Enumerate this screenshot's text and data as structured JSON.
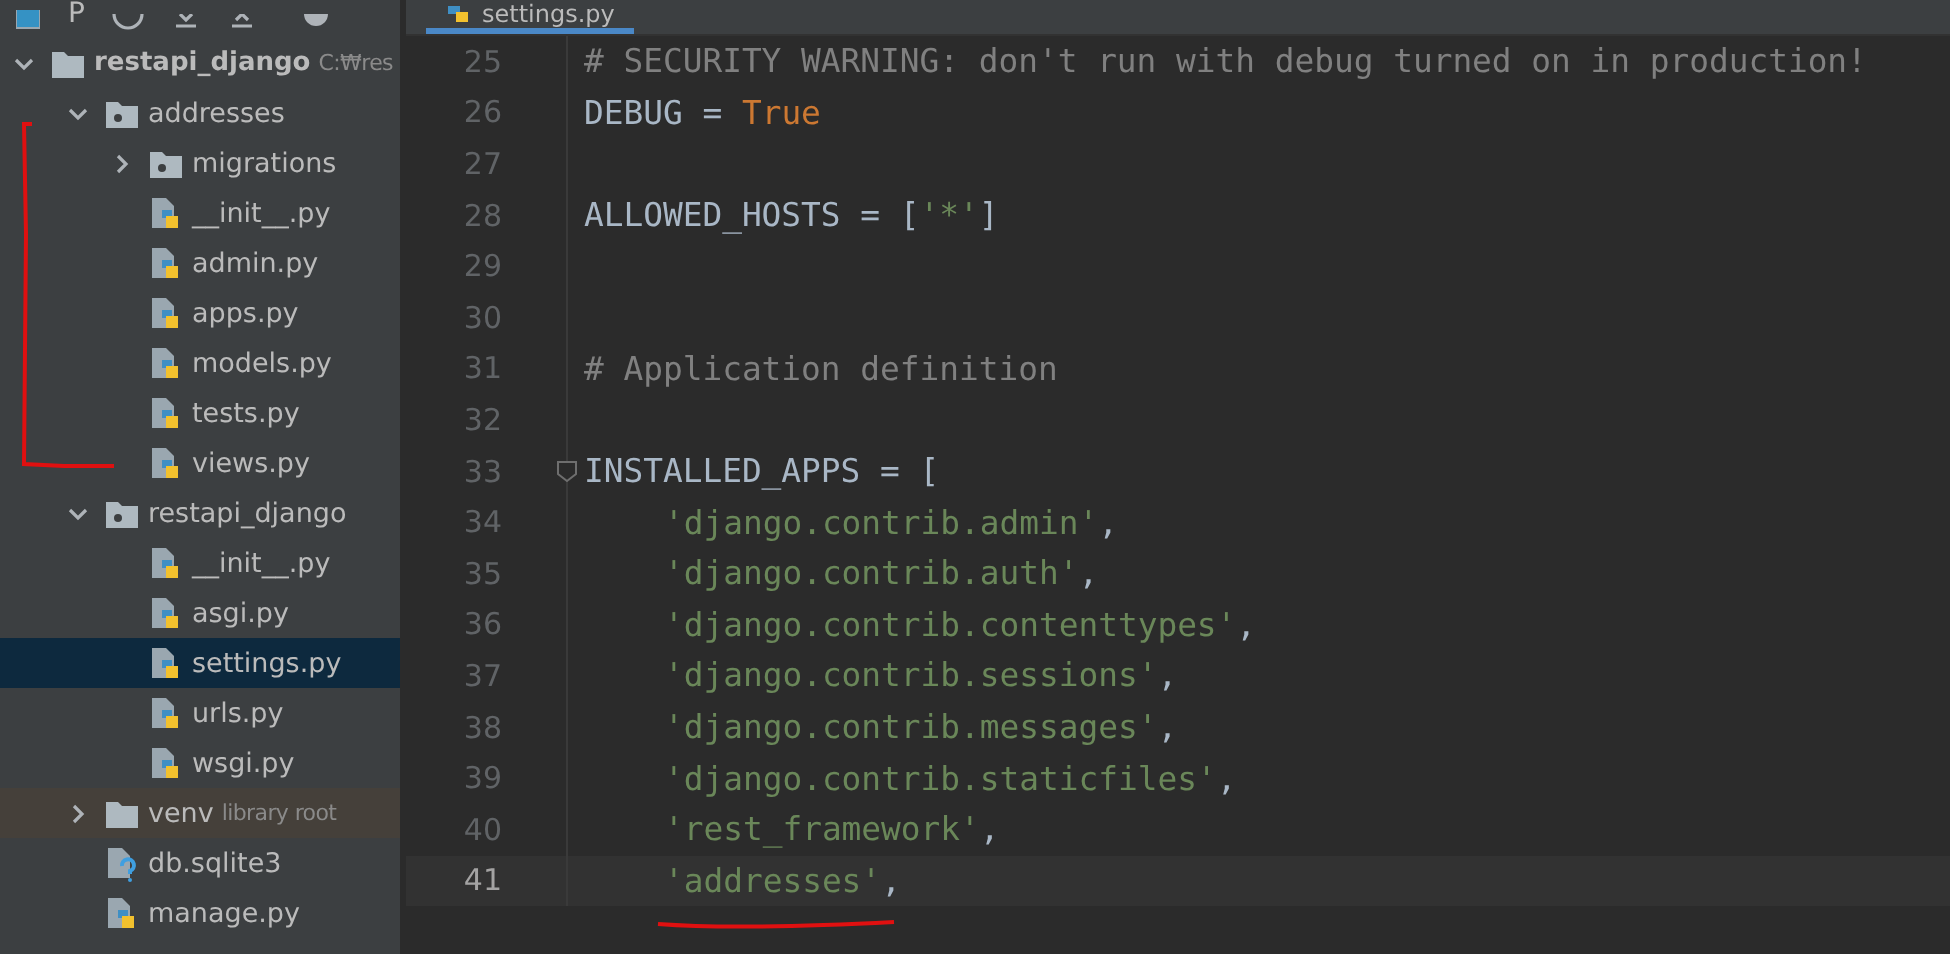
{
  "project_toolbar": {
    "title": "P"
  },
  "tree": [
    {
      "label": "restapi_django",
      "kind": "root",
      "hint": "C:₩res",
      "expanded": true,
      "selected": false,
      "children": [
        {
          "label": "addresses",
          "kind": "package",
          "expanded": true,
          "selected": false,
          "children": [
            {
              "label": "migrations",
              "kind": "package",
              "expanded": false,
              "selected": false
            },
            {
              "label": "__init__.py",
              "kind": "python",
              "selected": false
            },
            {
              "label": "admin.py",
              "kind": "python",
              "selected": false
            },
            {
              "label": "apps.py",
              "kind": "python",
              "selected": false
            },
            {
              "label": "models.py",
              "kind": "python",
              "selected": false
            },
            {
              "label": "tests.py",
              "kind": "python",
              "selected": false
            },
            {
              "label": "views.py",
              "kind": "python",
              "selected": false
            }
          ]
        },
        {
          "label": "restapi_django",
          "kind": "package",
          "expanded": true,
          "selected": false,
          "children": [
            {
              "label": "__init__.py",
              "kind": "python",
              "selected": false
            },
            {
              "label": "asgi.py",
              "kind": "python",
              "selected": false
            },
            {
              "label": "settings.py",
              "kind": "python",
              "selected": true
            },
            {
              "label": "urls.py",
              "kind": "python",
              "selected": false
            },
            {
              "label": "wsgi.py",
              "kind": "python",
              "selected": false
            }
          ]
        },
        {
          "label": "venv",
          "kind": "library",
          "hint": "library root",
          "expanded": false,
          "selected": false
        },
        {
          "label": "db.sqlite3",
          "kind": "unknown",
          "selected": false
        },
        {
          "label": "manage.py",
          "kind": "python",
          "selected": false
        }
      ]
    }
  ],
  "tabs": [
    {
      "label": "settings.py",
      "selected": true
    }
  ],
  "code_lines": [
    {
      "number": "25",
      "current": false,
      "tokens": [
        {
          "kind": "comment",
          "text": "# SECURITY WARNING: don't run with debug turned on in production!"
        }
      ]
    },
    {
      "number": "26",
      "current": false,
      "tokens": [
        {
          "kind": "plain",
          "text": "DEBUG = "
        },
        {
          "kind": "keyword",
          "text": "True"
        }
      ]
    },
    {
      "number": "27",
      "current": false
    },
    {
      "number": "28",
      "current": false,
      "tokens": [
        {
          "kind": "plain",
          "text": "ALLOWED_HOSTS = ["
        },
        {
          "kind": "string",
          "text": "'*'"
        },
        {
          "kind": "plain",
          "text": "]"
        }
      ]
    },
    {
      "number": "29",
      "current": false
    },
    {
      "number": "30",
      "current": false
    },
    {
      "number": "31",
      "current": false,
      "tokens": [
        {
          "kind": "comment",
          "text": "# Application definition"
        }
      ]
    },
    {
      "number": "32",
      "current": false
    },
    {
      "number": "33",
      "current": false,
      "fold": true,
      "tokens": [
        {
          "kind": "plain",
          "text": "INSTALLED_APPS = ["
        }
      ]
    },
    {
      "number": "34",
      "current": false,
      "indented": true,
      "tokens": [
        {
          "kind": "string",
          "text": "'django.contrib.admin'"
        },
        {
          "kind": "plain",
          "text": ","
        }
      ]
    },
    {
      "number": "35",
      "current": false,
      "indented": true,
      "tokens": [
        {
          "kind": "string",
          "text": "'django.contrib.auth'"
        },
        {
          "kind": "plain",
          "text": ","
        }
      ]
    },
    {
      "number": "36",
      "current": false,
      "indented": true,
      "tokens": [
        {
          "kind": "string",
          "text": "'django.contrib.contenttypes'"
        },
        {
          "kind": "plain",
          "text": ","
        }
      ]
    },
    {
      "number": "37",
      "current": false,
      "indented": true,
      "tokens": [
        {
          "kind": "string",
          "text": "'django.contrib.sessions'"
        },
        {
          "kind": "plain",
          "text": ","
        }
      ]
    },
    {
      "number": "38",
      "current": false,
      "indented": true,
      "tokens": [
        {
          "kind": "string",
          "text": "'django.contrib.messages'"
        },
        {
          "kind": "plain",
          "text": ","
        }
      ]
    },
    {
      "number": "39",
      "current": false,
      "indented": true,
      "tokens": [
        {
          "kind": "string",
          "text": "'django.contrib.staticfiles'"
        },
        {
          "kind": "plain",
          "text": ","
        }
      ]
    },
    {
      "number": "40",
      "current": false,
      "indented": true,
      "tokens": [
        {
          "kind": "string",
          "text": "'rest_framework'"
        },
        {
          "kind": "plain",
          "text": ","
        }
      ]
    },
    {
      "number": "41",
      "current": true,
      "indented": true,
      "tokens": [
        {
          "kind": "string",
          "text": "'addresses'"
        },
        {
          "kind": "plain",
          "text": ","
        }
      ]
    }
  ]
}
